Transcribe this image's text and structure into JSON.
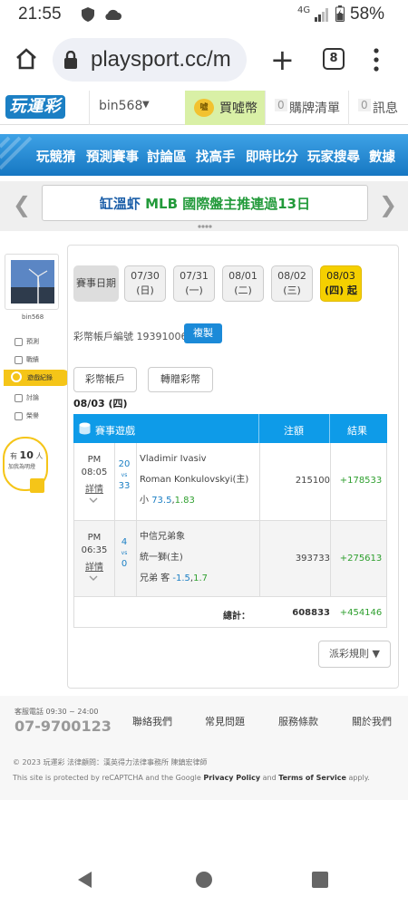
{
  "status_bar": {
    "time": "21:55",
    "network": "4G",
    "battery_pct": "58%"
  },
  "browser": {
    "url": "playsport.cc/m",
    "tab_count": "8"
  },
  "site_header": {
    "logo": "玩運彩",
    "username": "bin568",
    "buy_label": "買噓幣",
    "coin_text": "噓",
    "cart_count": "0",
    "cart_label": "購牌清單",
    "msg_count": "0",
    "msg_label": "訊息"
  },
  "nav": {
    "items": [
      "玩競猜",
      "預測賽事",
      "討論區",
      "找高手",
      "即時比分",
      "玩家搜尋",
      "數據"
    ]
  },
  "banner": {
    "name": "缸溫虾",
    "text": " MLB 國際盤主推連過13日"
  },
  "sidebar": {
    "username": "bin568",
    "items": [
      "預測",
      "戰績",
      "遊戲紀錄",
      "討論",
      "榮譽"
    ],
    "active": "遊戲紀錄",
    "promo_prefix": "有",
    "promo_count": "10",
    "promo_unit": "人",
    "promo_sub": "加我為明燈"
  },
  "dates": {
    "label": "賽事日期",
    "items": [
      {
        "date": "07/30",
        "day": "(日)"
      },
      {
        "date": "07/31",
        "day": "(一)"
      },
      {
        "date": "08/01",
        "day": "(二)"
      },
      {
        "date": "08/02",
        "day": "(三)"
      },
      {
        "date": "08/03",
        "day": "(四) 起"
      }
    ],
    "selected": "08/03"
  },
  "account": {
    "label": "彩幣帳戶編號",
    "number": "19391006",
    "copy_label": "複製"
  },
  "tabs": {
    "account_tab": "彩幣帳戶",
    "transfer_tab": "轉贈彩幣"
  },
  "current_date": "08/03 (四)",
  "table": {
    "headers": {
      "game": "賽事遊戲",
      "stake": "注額",
      "result": "結果"
    },
    "rows": [
      {
        "ampm": "PM",
        "time": "08:05",
        "detail": "詳情",
        "score_home": "20",
        "vs": "vs",
        "score_away": "33",
        "team1": "Vladimir Ivasiv",
        "team2": "Roman Konkulovskyi(主)",
        "bet_prefix": "小",
        "bet_line": "73.5",
        "bet_sep": ",",
        "bet_odds": "1.83",
        "stake": "215100",
        "result": "+178533"
      },
      {
        "ampm": "PM",
        "time": "06:35",
        "detail": "詳情",
        "score_home": "4",
        "vs": "vs",
        "score_away": "0",
        "team1": "中信兄弟象",
        "team2": "統一獅(主)",
        "bet_prefix": "兄弟 客",
        "bet_line": "-1.5",
        "bet_sep": ",",
        "bet_odds": "1.7",
        "stake": "393733",
        "result": "+275613"
      }
    ],
    "total_label": "總計：",
    "total_stake": "608833",
    "total_result": "+454146"
  },
  "rules_label": "派彩規則 ▼",
  "footer": {
    "service_label": "客服電話 09:30 ~ 24:00",
    "phone": "07-9700123",
    "links": [
      "聯絡我們",
      "常見問題",
      "服務條款",
      "關於我們"
    ],
    "copyright": "© 2023 玩運彩 法律顧問：漢英得力法律事務所 陳鎮宏律師",
    "recaptcha_prefix": "This site is protected by reCAPTCHA and the Google ",
    "privacy": "Privacy Policy",
    "and": " and ",
    "terms": "Terms of Service",
    "recaptcha_suffix": " apply."
  },
  "colors": {
    "nav_blue": "#1677c2",
    "table_header": "#0e9be8",
    "accent_yellow": "#f5c518",
    "win_green": "#2e9f2e"
  }
}
